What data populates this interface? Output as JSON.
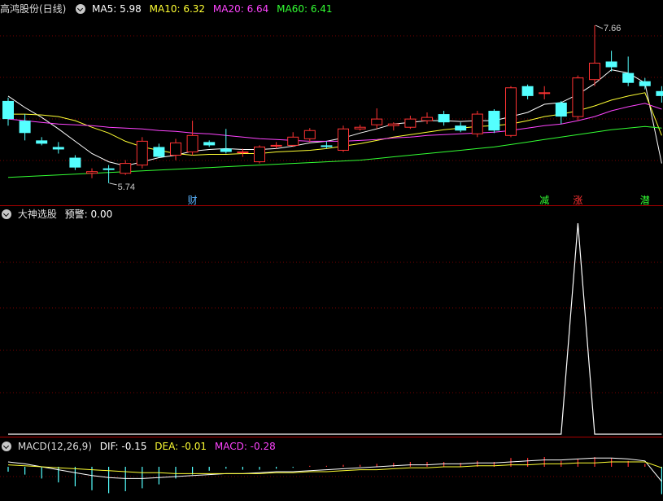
{
  "panels": {
    "main": {
      "title": "高鸿股份(日线)",
      "indicators": [
        {
          "label": "MA5: 5.98",
          "color": "#ffffff"
        },
        {
          "label": "MA10: 6.32",
          "color": "#ffff33"
        },
        {
          "label": "MA20: 6.64",
          "color": "#ff44ff"
        },
        {
          "label": "MA60: 6.41",
          "color": "#33ff33"
        }
      ]
    },
    "signal": {
      "title": "大神选股",
      "indicators": [
        {
          "label": "预警: 0.00",
          "color": "#ffffff"
        }
      ]
    },
    "macd": {
      "title": "MACD(12,26,9)",
      "indicators": [
        {
          "label": "DIF: -0.15",
          "color": "#ffffff"
        },
        {
          "label": "DEA: -0.01",
          "color": "#ffff33"
        },
        {
          "label": "MACD: -0.28",
          "color": "#ff44ff"
        }
      ]
    }
  },
  "chart_data": [
    {
      "type": "candlestick",
      "title": "高鸿股份(日线)",
      "y_range": [
        5.55,
        7.75
      ],
      "up_color": "#ff3333",
      "down_color": "#54ffff",
      "candles": [
        {
          "o": 6.74,
          "h": 6.78,
          "l": 6.44,
          "c": 6.52
        },
        {
          "o": 6.5,
          "h": 6.58,
          "l": 6.26,
          "c": 6.35
        },
        {
          "o": 6.26,
          "h": 6.3,
          "l": 6.2,
          "c": 6.22
        },
        {
          "o": 6.18,
          "h": 6.24,
          "l": 6.1,
          "c": 6.15
        },
        {
          "o": 6.05,
          "h": 6.08,
          "l": 5.9,
          "c": 5.93
        },
        {
          "o": 5.86,
          "h": 5.92,
          "l": 5.8,
          "c": 5.88
        },
        {
          "o": 5.92,
          "h": 5.96,
          "l": 5.74,
          "c": 5.9
        },
        {
          "o": 5.86,
          "h": 6.02,
          "l": 5.84,
          "c": 5.98
        },
        {
          "o": 5.96,
          "h": 6.3,
          "l": 5.92,
          "c": 6.25
        },
        {
          "o": 6.18,
          "h": 6.22,
          "l": 6.05,
          "c": 6.06
        },
        {
          "o": 6.08,
          "h": 6.28,
          "l": 6.02,
          "c": 6.23
        },
        {
          "o": 6.12,
          "h": 6.5,
          "l": 6.08,
          "c": 6.32
        },
        {
          "o": 6.24,
          "h": 6.26,
          "l": 6.18,
          "c": 6.2
        },
        {
          "o": 6.16,
          "h": 6.4,
          "l": 6.1,
          "c": 6.12
        },
        {
          "o": 6.12,
          "h": 6.16,
          "l": 6.06,
          "c": 6.12
        },
        {
          "o": 6.0,
          "h": 6.2,
          "l": 5.98,
          "c": 6.18
        },
        {
          "o": 6.2,
          "h": 6.24,
          "l": 6.16,
          "c": 6.2
        },
        {
          "o": 6.2,
          "h": 6.36,
          "l": 6.18,
          "c": 6.3
        },
        {
          "o": 6.28,
          "h": 6.41,
          "l": 6.24,
          "c": 6.38
        },
        {
          "o": 6.2,
          "h": 6.25,
          "l": 6.16,
          "c": 6.18
        },
        {
          "o": 6.14,
          "h": 6.44,
          "l": 6.12,
          "c": 6.4
        },
        {
          "o": 6.4,
          "h": 6.45,
          "l": 6.38,
          "c": 6.42
        },
        {
          "o": 6.45,
          "h": 6.65,
          "l": 6.4,
          "c": 6.52
        },
        {
          "o": 6.44,
          "h": 6.48,
          "l": 6.38,
          "c": 6.46
        },
        {
          "o": 6.42,
          "h": 6.56,
          "l": 6.4,
          "c": 6.52
        },
        {
          "o": 6.5,
          "h": 6.6,
          "l": 6.46,
          "c": 6.54
        },
        {
          "o": 6.58,
          "h": 6.62,
          "l": 6.44,
          "c": 6.48
        },
        {
          "o": 6.44,
          "h": 6.48,
          "l": 6.36,
          "c": 6.38
        },
        {
          "o": 6.34,
          "h": 6.62,
          "l": 6.3,
          "c": 6.58
        },
        {
          "o": 6.62,
          "h": 6.64,
          "l": 6.35,
          "c": 6.38
        },
        {
          "o": 6.32,
          "h": 6.92,
          "l": 6.3,
          "c": 6.9
        },
        {
          "o": 6.92,
          "h": 6.94,
          "l": 6.76,
          "c": 6.8
        },
        {
          "o": 6.84,
          "h": 6.92,
          "l": 6.76,
          "c": 6.84
        },
        {
          "o": 6.72,
          "h": 6.74,
          "l": 6.46,
          "c": 6.55
        },
        {
          "o": 6.55,
          "h": 7.05,
          "l": 6.5,
          "c": 7.02
        },
        {
          "o": 7.0,
          "h": 7.66,
          "l": 6.92,
          "c": 7.2
        },
        {
          "o": 7.22,
          "h": 7.35,
          "l": 7.1,
          "c": 7.15
        },
        {
          "o": 7.08,
          "h": 7.28,
          "l": 6.92,
          "c": 6.96
        },
        {
          "o": 6.98,
          "h": 7.02,
          "l": 6.88,
          "c": 6.92
        },
        {
          "o": 6.86,
          "h": 6.92,
          "l": 6.72,
          "c": 6.8
        }
      ],
      "series": [
        {
          "name": "MA5",
          "color": "#ffffff",
          "values": [
            6.8,
            6.66,
            6.54,
            6.4,
            6.25,
            6.1,
            6.0,
            5.95,
            6.0,
            6.05,
            6.08,
            6.13,
            6.15,
            6.16,
            6.15,
            6.15,
            6.16,
            6.19,
            6.23,
            6.25,
            6.29,
            6.35,
            6.4,
            6.46,
            6.48,
            6.5,
            6.5,
            6.49,
            6.5,
            6.5,
            6.55,
            6.6,
            6.7,
            6.72,
            6.82,
            6.95,
            7.12,
            7.08,
            6.96,
            5.98
          ]
        },
        {
          "name": "MA10",
          "color": "#ffff33",
          "values": [
            6.58,
            6.58,
            6.57,
            6.55,
            6.5,
            6.42,
            6.35,
            6.25,
            6.18,
            6.14,
            6.1,
            6.08,
            6.09,
            6.09,
            6.1,
            6.1,
            6.12,
            6.13,
            6.14,
            6.16,
            6.19,
            6.22,
            6.26,
            6.3,
            6.33,
            6.36,
            6.39,
            6.41,
            6.43,
            6.44,
            6.46,
            6.5,
            6.55,
            6.58,
            6.62,
            6.68,
            6.75,
            6.8,
            6.84,
            6.32
          ]
        },
        {
          "name": "MA20",
          "color": "#ff44ff",
          "values": [
            6.52,
            6.5,
            6.48,
            6.46,
            6.45,
            6.44,
            6.42,
            6.41,
            6.4,
            6.38,
            6.37,
            6.35,
            6.34,
            6.32,
            6.3,
            6.28,
            6.27,
            6.26,
            6.25,
            6.25,
            6.25,
            6.26,
            6.27,
            6.29,
            6.3,
            6.32,
            6.33,
            6.34,
            6.35,
            6.36,
            6.38,
            6.41,
            6.44,
            6.46,
            6.5,
            6.55,
            6.62,
            6.67,
            6.71,
            6.64
          ]
        },
        {
          "name": "MA60",
          "color": "#33ff33",
          "values": [
            5.81,
            5.82,
            5.83,
            5.84,
            5.85,
            5.86,
            5.87,
            5.88,
            5.89,
            5.9,
            5.91,
            5.92,
            5.93,
            5.94,
            5.95,
            5.96,
            5.97,
            5.98,
            5.99,
            6.0,
            6.01,
            6.02,
            6.04,
            6.06,
            6.08,
            6.1,
            6.12,
            6.14,
            6.16,
            6.18,
            6.21,
            6.24,
            6.27,
            6.3,
            6.33,
            6.36,
            6.39,
            6.41,
            6.43,
            6.41
          ]
        }
      ],
      "annotations": [
        {
          "text": "7.66",
          "index": 35,
          "price": 7.66,
          "color": "#cccccc"
        },
        {
          "text": "5.74",
          "index": 6,
          "price": 5.74,
          "color": "#cccccc"
        }
      ],
      "markers": [
        {
          "text": "财",
          "index": 11,
          "color": "#5ab4ff"
        },
        {
          "text": "减",
          "index": 32,
          "color": "#33ff33"
        },
        {
          "text": "涨",
          "index": 34,
          "color": "#ff3333"
        },
        {
          "text": "潜",
          "index": 38,
          "color": "#33ff33"
        }
      ]
    },
    {
      "type": "line",
      "title": "大神选股",
      "y_range": [
        0,
        1
      ],
      "series": [
        {
          "name": "预警",
          "color": "#ffffff",
          "values": [
            0,
            0,
            0,
            0,
            0,
            0,
            0,
            0,
            0,
            0,
            0,
            0,
            0,
            0,
            0,
            0,
            0,
            0,
            0,
            0,
            0,
            0,
            0,
            0,
            0,
            0,
            0,
            0,
            0,
            0,
            0,
            0,
            0,
            0,
            1,
            0,
            0,
            0,
            0,
            0
          ]
        }
      ]
    },
    {
      "type": "macd",
      "title": "MACD(12,26,9)",
      "y_range": [
        -0.35,
        0.15
      ],
      "macd": [
        -0.05,
        -0.08,
        -0.12,
        -0.16,
        -0.2,
        -0.24,
        -0.27,
        -0.25,
        -0.22,
        -0.18,
        -0.12,
        -0.08,
        -0.04,
        -0.02,
        -0.03,
        -0.03,
        -0.02,
        -0.01,
        0.01,
        0.01,
        0.02,
        0.02,
        0.03,
        0.04,
        0.05,
        0.05,
        0.05,
        0.04,
        0.06,
        0.05,
        0.09,
        0.09,
        0.1,
        0.06,
        0.08,
        0.1,
        0.09,
        0.06,
        0.03,
        -0.28
      ],
      "series": [
        {
          "name": "DIF",
          "color": "#ffffff",
          "values": [
            0.05,
            0.03,
            0.0,
            -0.03,
            -0.06,
            -0.09,
            -0.11,
            -0.12,
            -0.12,
            -0.11,
            -0.1,
            -0.09,
            -0.08,
            -0.07,
            -0.07,
            -0.06,
            -0.05,
            -0.05,
            -0.04,
            -0.03,
            -0.02,
            -0.01,
            0.0,
            0.01,
            0.02,
            0.02,
            0.03,
            0.03,
            0.04,
            0.04,
            0.05,
            0.06,
            0.07,
            0.07,
            0.08,
            0.09,
            0.09,
            0.08,
            0.06,
            -0.15
          ]
        },
        {
          "name": "DEA",
          "color": "#ffff33",
          "values": [
            0.02,
            0.01,
            0.0,
            -0.01,
            -0.02,
            -0.03,
            -0.04,
            -0.05,
            -0.06,
            -0.06,
            -0.07,
            -0.07,
            -0.07,
            -0.07,
            -0.07,
            -0.07,
            -0.06,
            -0.06,
            -0.05,
            -0.05,
            -0.04,
            -0.03,
            -0.03,
            -0.02,
            -0.01,
            -0.01,
            0.0,
            0.0,
            0.01,
            0.01,
            0.02,
            0.02,
            0.03,
            0.03,
            0.04,
            0.04,
            0.05,
            0.05,
            0.05,
            -0.01
          ]
        }
      ]
    }
  ]
}
